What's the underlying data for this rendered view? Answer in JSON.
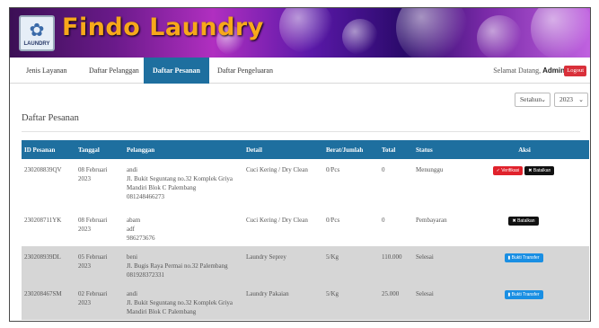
{
  "brand": {
    "name": "Findo Laundry",
    "logo_caption": "LAUNDRY"
  },
  "nav": {
    "items": [
      {
        "label": "Jenis Layanan"
      },
      {
        "label": "Daftar Pelanggan"
      },
      {
        "label": "Daftar Pesanan",
        "active": true
      },
      {
        "label": "Daftar Pengeluaran"
      }
    ],
    "welcome": "Selamat Datang,",
    "user": "Admin",
    "logout": "Logout"
  },
  "filters": {
    "period": "Setahun",
    "year": "2023"
  },
  "page_title": "Daftar Pesanan",
  "table": {
    "headers": [
      "ID Pesanan",
      "Tanggal",
      "Pelanggan",
      "Detail",
      "Berat/Jumlah",
      "Total",
      "Status",
      "Aksi"
    ],
    "rows": [
      {
        "id": "230208839QV",
        "date": "08 Februari 2023",
        "name": "andi",
        "address": "Jl. Bukit Seguntang no.32 Komplek Griya Mandiri Blok C Palembang",
        "phone": "081248466273",
        "detail": "Cuci Kering / Dry Clean",
        "qty": "0/Pcs",
        "total": "0",
        "status": "Menunggu",
        "actions": [
          "Verifikasi",
          "Batalkan"
        ]
      },
      {
        "id": "230208711YK",
        "date": "08 Februari 2023",
        "name": "abam",
        "address": "adf",
        "phone": "986273676",
        "detail": "Cuci Kering / Dry Clean",
        "qty": "0/Pcs",
        "total": "0",
        "status": "Pembayaran",
        "actions": [
          "Batalkan"
        ]
      },
      {
        "id": "230208939DL",
        "date": "05 Februari 2023",
        "name": "beni",
        "address": "Jl. Bugis Raya Permai no.32 Palembang",
        "phone": "081928372331",
        "detail": "Laundry Seprey",
        "qty": "5/Kg",
        "total": "110.000",
        "status": "Selesai",
        "actions": [
          "Bukti Transfer"
        ]
      },
      {
        "id": "230208467SM",
        "date": "02 Februari 2023",
        "name": "andi",
        "address": "Jl. Bukit Seguntang no.32 Komplek Griya Mandiri Blok C Palembang",
        "phone": "",
        "detail": "Laundry Pakaian",
        "qty": "5/Kg",
        "total": "25.000",
        "status": "Selesai",
        "actions": [
          "Bukti Transfer"
        ]
      }
    ]
  },
  "colors": {
    "header_blue": "#1e6f9f",
    "brand_orange": "#f7a81b",
    "danger": "#e0222c",
    "info": "#1a8fe3"
  }
}
